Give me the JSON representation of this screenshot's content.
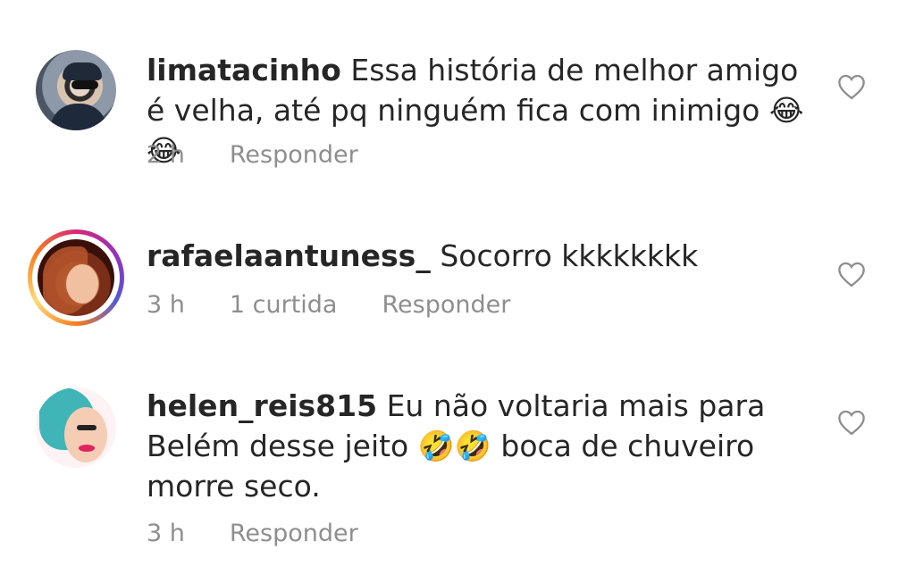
{
  "comments": [
    {
      "username": "limatacinho",
      "text": "Essa história de melhor amigo é velha, até pq ninguém fica com inimigo 😂😂",
      "time": "2 h",
      "likes": "",
      "reply_label": "Responder",
      "has_story_ring": false
    },
    {
      "username": "rafaelaantuness_",
      "text": "Socorro kkkkkkkk",
      "time": "3 h",
      "likes": "1 curtida",
      "reply_label": "Responder",
      "has_story_ring": true
    },
    {
      "username": "helen_reis815",
      "text": "Eu não voltaria mais para Belém desse jeito 🤣🤣 boca de chuveiro morre seco.",
      "time": "3 h",
      "likes": "",
      "reply_label": "Responder",
      "has_story_ring": false
    }
  ],
  "icons": {
    "like": "heart-outline-icon"
  },
  "colors": {
    "text": "#262626",
    "meta": "#8e8e8e",
    "heart_stroke": "#8e8e8e"
  }
}
